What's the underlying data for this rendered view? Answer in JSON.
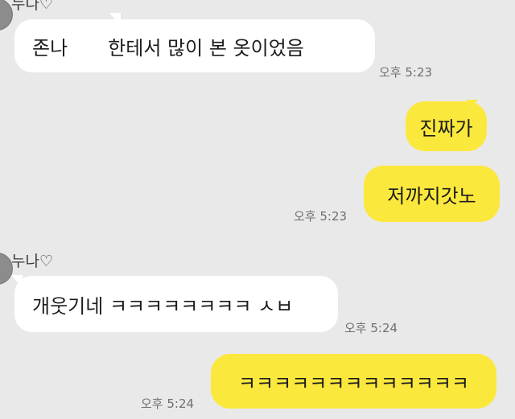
{
  "contact": {
    "name": "누나♡"
  },
  "messages": [
    {
      "id": "m1",
      "direction": "incoming",
      "text_before": "존나",
      "text_after": "한테서 많이 본 옷이었음",
      "time": "오후 5:23"
    },
    {
      "id": "m2",
      "direction": "outgoing",
      "text": "진짜가"
    },
    {
      "id": "m3",
      "direction": "outgoing",
      "text": "저까지갓노",
      "time": "오후 5:23"
    },
    {
      "id": "m4",
      "direction": "incoming",
      "text": "개웃기네 ㅋㅋㅋㅋㅋㅋㅋㅋ ㅅㅂ",
      "time": "오후 5:24"
    },
    {
      "id": "m5",
      "direction": "outgoing",
      "text": "ㅋㅋㅋㅋㅋㅋㅋㅋㅋㅋㅋㅋㅋ",
      "time": "오후 5:24"
    }
  ],
  "colors": {
    "background": "#e9e9e9",
    "incoming_bubble": "#ffffff",
    "outgoing_bubble": "#fbe83c",
    "timestamp": "#6f6f6f"
  }
}
